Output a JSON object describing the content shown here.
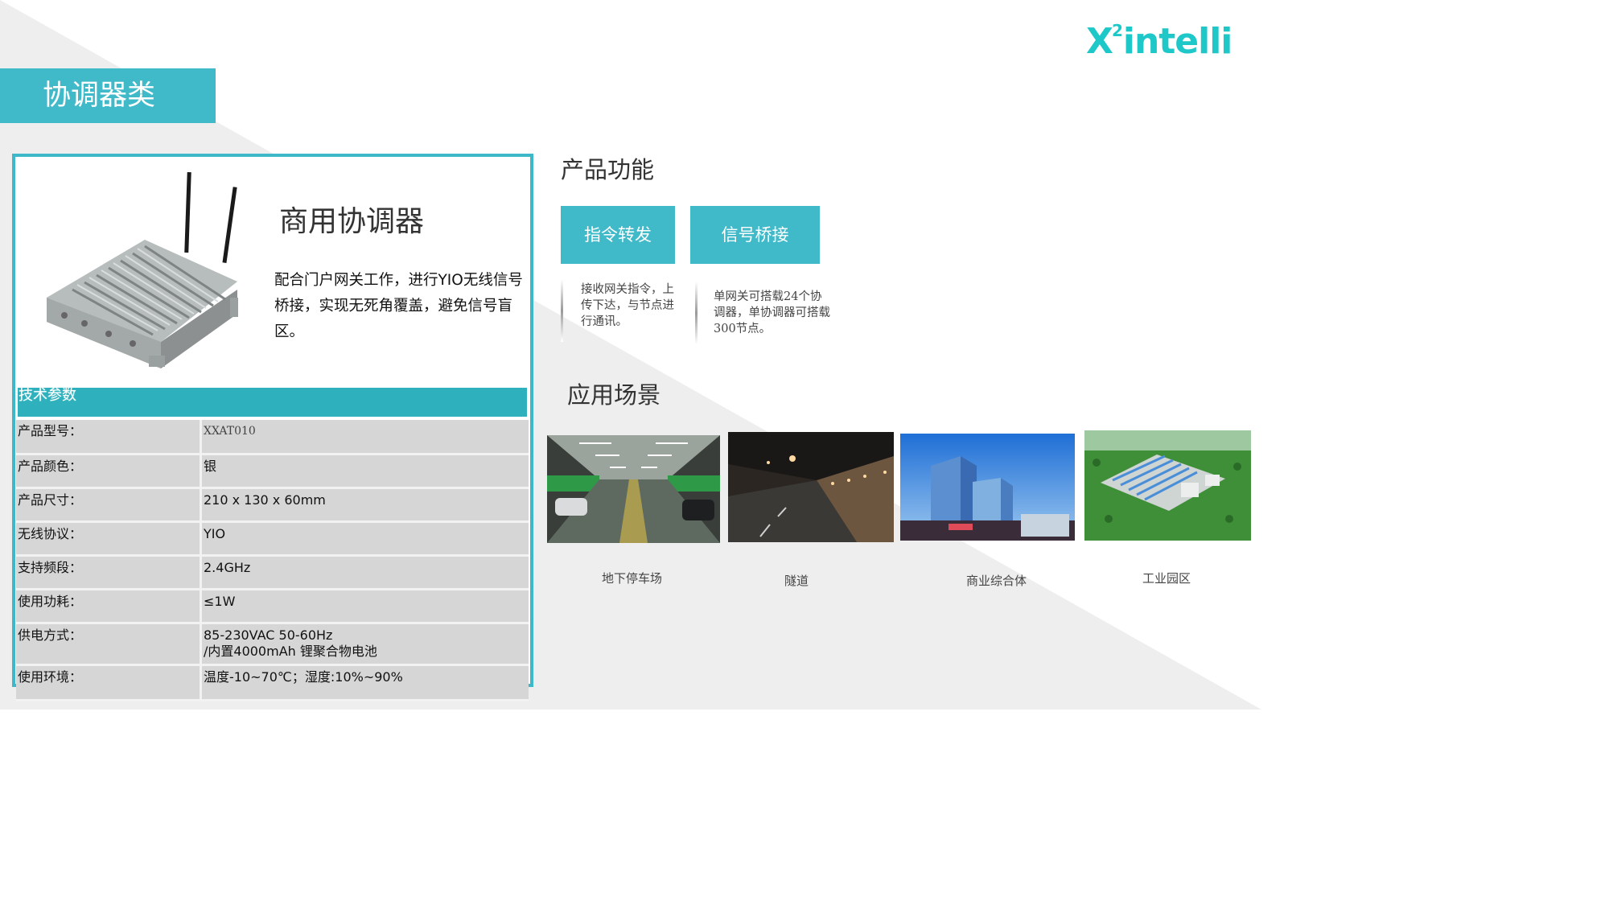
{
  "logo": {
    "prefix": "X",
    "superscript": "2",
    "word": "intelli"
  },
  "category_title": "协调器类",
  "product": {
    "name": "商用协调器",
    "description": "配合门户网关工作，进行YIO无线信号桥接，实现无死角覆盖，避免信号盲区。"
  },
  "specs": {
    "header": "技术参数",
    "rows": [
      {
        "label": "产品型号：",
        "value": "XXAT010"
      },
      {
        "label": "产品颜色：",
        "value": "银"
      },
      {
        "label": "产品尺寸：",
        "value": "210 x 130 x 60mm"
      },
      {
        "label": "无线协议：",
        "value": "YIO"
      },
      {
        "label": "支持频段：",
        "value": "2.4GHz"
      },
      {
        "label": "使用功耗：",
        "value": "≤1W"
      },
      {
        "label": "供电方式：",
        "value": "85-230VAC 50-60Hz\n/内置4000mAh 锂聚合物电池"
      },
      {
        "label": "使用环境：",
        "value": "温度-10~70℃；湿度:10%~90%"
      }
    ]
  },
  "functions": {
    "title": "产品功能",
    "items": [
      {
        "label": "指令转发",
        "description": "接收网关指令，上传下达，与节点进行通讯。"
      },
      {
        "label": "信号桥接",
        "description": "单网关可搭载24个协调器，单协调器可搭载300节点。"
      }
    ]
  },
  "scenarios": {
    "title": "应用场景",
    "items": [
      {
        "caption": "地下停车场"
      },
      {
        "caption": "隧道"
      },
      {
        "caption": "商业综合体"
      },
      {
        "caption": "工业园区"
      }
    ]
  },
  "colors": {
    "accent": "#40b9c9",
    "logo": "#1ec8c8",
    "table_header": "#2fb1bd"
  }
}
